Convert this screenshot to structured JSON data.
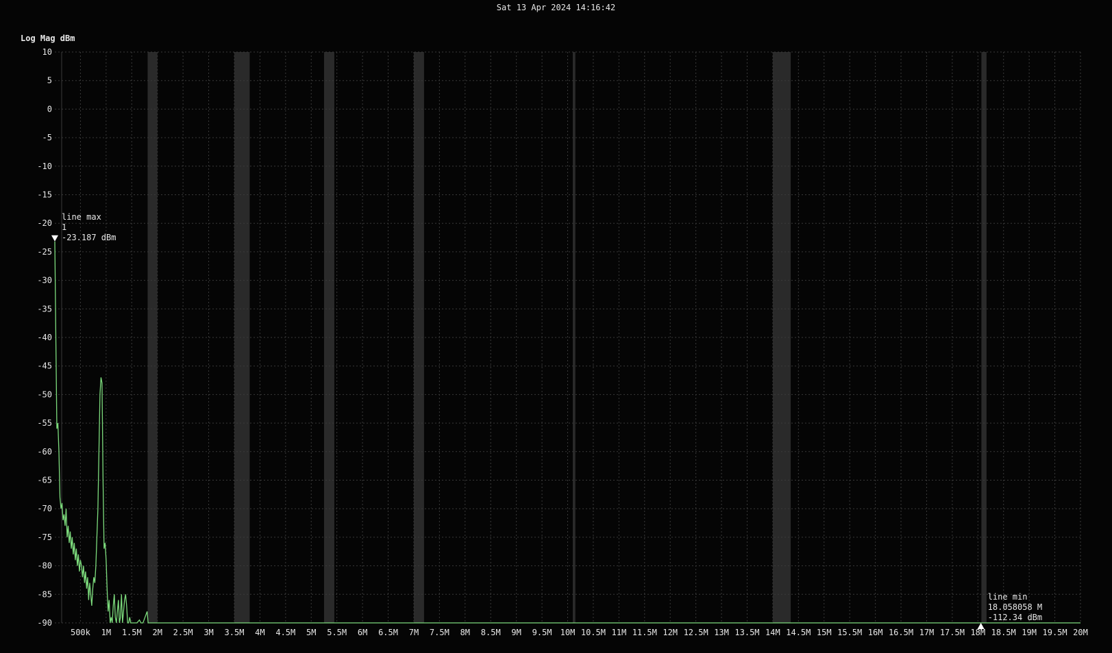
{
  "header": {
    "timestamp": "Sat 13 Apr 2024 14:16:42"
  },
  "colors": {
    "background": "#050505",
    "grid": "#3a3a3a",
    "band": "#2a2a2a",
    "trace": "#7ddc7d",
    "text": "#e8e8e8",
    "marker": "#ffffff"
  },
  "chart_data": {
    "type": "line",
    "ylabel": "Log Mag dBm",
    "xlabel": "",
    "title": "",
    "xlim": [
      0,
      20000000
    ],
    "ylim": [
      -90,
      10
    ],
    "grid": true,
    "y_ticks": [
      10,
      5,
      0,
      -5,
      -10,
      -15,
      -20,
      -25,
      -30,
      -35,
      -40,
      -45,
      -50,
      -55,
      -60,
      -65,
      -70,
      -75,
      -80,
      -85,
      -90
    ],
    "x_ticks": [
      {
        "value": 500000,
        "label": "500k"
      },
      {
        "value": 1000000,
        "label": "1M"
      },
      {
        "value": 1500000,
        "label": "1.5M"
      },
      {
        "value": 2000000,
        "label": "2M"
      },
      {
        "value": 2500000,
        "label": "2.5M"
      },
      {
        "value": 3000000,
        "label": "3M"
      },
      {
        "value": 3500000,
        "label": "3.5M"
      },
      {
        "value": 4000000,
        "label": "4M"
      },
      {
        "value": 4500000,
        "label": "4.5M"
      },
      {
        "value": 5000000,
        "label": "5M"
      },
      {
        "value": 5500000,
        "label": "5.5M"
      },
      {
        "value": 6000000,
        "label": "6M"
      },
      {
        "value": 6500000,
        "label": "6.5M"
      },
      {
        "value": 7000000,
        "label": "7M"
      },
      {
        "value": 7500000,
        "label": "7.5M"
      },
      {
        "value": 8000000,
        "label": "8M"
      },
      {
        "value": 8500000,
        "label": "8.5M"
      },
      {
        "value": 9000000,
        "label": "9M"
      },
      {
        "value": 9500000,
        "label": "9.5M"
      },
      {
        "value": 10000000,
        "label": "10M"
      },
      {
        "value": 10500000,
        "label": "10.5M"
      },
      {
        "value": 11000000,
        "label": "11M"
      },
      {
        "value": 11500000,
        "label": "11.5M"
      },
      {
        "value": 12000000,
        "label": "12M"
      },
      {
        "value": 12500000,
        "label": "12.5M"
      },
      {
        "value": 13000000,
        "label": "13M"
      },
      {
        "value": 13500000,
        "label": "13.5M"
      },
      {
        "value": 14000000,
        "label": "14M"
      },
      {
        "value": 14500000,
        "label": "14.5M"
      },
      {
        "value": 15000000,
        "label": "15M"
      },
      {
        "value": 15500000,
        "label": "15.5M"
      },
      {
        "value": 16000000,
        "label": "16M"
      },
      {
        "value": 16500000,
        "label": "16.5M"
      },
      {
        "value": 17000000,
        "label": "17M"
      },
      {
        "value": 17500000,
        "label": "17.5M"
      },
      {
        "value": 18000000,
        "label": "18M"
      },
      {
        "value": 18500000,
        "label": "18.5M"
      },
      {
        "value": 19000000,
        "label": "19M"
      },
      {
        "value": 19500000,
        "label": "19.5M"
      },
      {
        "value": 20000000,
        "label": "20M"
      }
    ],
    "bands": [
      [
        1810000,
        2000000
      ],
      [
        3500000,
        3800000
      ],
      [
        5250000,
        5450000
      ],
      [
        7000000,
        7200000
      ],
      [
        10100000,
        10150000
      ],
      [
        14000000,
        14350000
      ],
      [
        18068000,
        18168000
      ]
    ],
    "series": [
      {
        "x": [
          1,
          20000,
          40000,
          60000,
          80000,
          100000,
          120000,
          140000,
          160000,
          180000,
          200000,
          220000,
          240000,
          260000,
          280000,
          300000,
          320000,
          340000,
          360000,
          380000,
          400000,
          420000,
          440000,
          460000,
          480000,
          500000,
          520000,
          540000,
          560000,
          580000,
          600000,
          620000,
          640000,
          660000,
          680000,
          700000,
          720000,
          740000,
          760000,
          780000,
          800000,
          820000,
          840000,
          860000,
          880000,
          900000,
          920000,
          940000,
          960000,
          980000,
          1000000,
          1020000,
          1040000,
          1060000,
          1080000,
          1100000,
          1120000,
          1140000,
          1160000,
          1180000,
          1200000,
          1220000,
          1240000,
          1260000,
          1280000,
          1300000,
          1320000,
          1340000,
          1360000,
          1380000,
          1400000,
          1420000,
          1440000,
          1460000,
          1480000,
          1500000,
          1520000,
          1540000,
          1560000,
          1600000,
          1650000,
          1680000,
          1700000,
          1720000,
          1760000,
          1800000,
          1820000,
          1840000,
          1860000,
          1900000,
          2000000,
          5000000,
          10000000,
          15000000,
          18058058,
          20000000
        ],
        "y": [
          -23.187,
          -40,
          -56,
          -55,
          -60,
          -68,
          -70,
          -69,
          -72,
          -71,
          -73,
          -70,
          -75,
          -73,
          -76,
          -74,
          -77,
          -75,
          -78,
          -76,
          -79,
          -77,
          -80,
          -78,
          -81,
          -79,
          -80,
          -82,
          -80,
          -83,
          -81,
          -84,
          -82,
          -86,
          -83,
          -85,
          -87,
          -84,
          -82,
          -83,
          -80,
          -75,
          -70,
          -60,
          -50,
          -47,
          -48,
          -65,
          -77,
          -76,
          -79,
          -84,
          -88,
          -86,
          -90,
          -89,
          -90,
          -87,
          -85,
          -89,
          -90,
          -88,
          -86,
          -90,
          -89,
          -85,
          -90,
          -88,
          -86,
          -85,
          -87,
          -90,
          -90,
          -89,
          -90,
          -90,
          -90,
          -90,
          -90,
          -90,
          -89.5,
          -90,
          -90,
          -90,
          -89,
          -88,
          -90,
          -90,
          -90,
          -90,
          -90,
          -90,
          -90,
          -90,
          -90,
          -90
        ]
      }
    ],
    "markers": [
      {
        "name": "line max",
        "label": "line max",
        "line2": "1",
        "line3": "-23.187 dBm",
        "x": 1,
        "y": -23.187,
        "pointing": "down"
      },
      {
        "name": "line min",
        "label": "line min",
        "line2": "18.058058 M",
        "line3": "-112.34 dBm",
        "x": 18058058,
        "y": -90,
        "pointing": "up"
      }
    ]
  }
}
